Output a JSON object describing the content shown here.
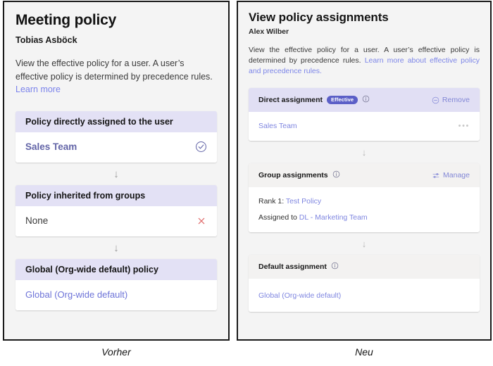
{
  "old_panel": {
    "title": "Meeting policy",
    "user": "Tobias Asböck",
    "description_before_link": "View the effective policy for a user. A user’s effective policy is determined by precedence rules. ",
    "link_label": "Learn more",
    "cards": [
      {
        "header": "Policy directly assigned to the user",
        "value": "Sales Team",
        "value_style": "strong-link",
        "status_icon": "check-circle-icon",
        "status_color": "#6264a7"
      },
      {
        "header": "Policy inherited from groups",
        "value": "None",
        "value_style": "plain",
        "status_icon": "close-x-icon",
        "status_color": "#e06c6c"
      },
      {
        "header": "Global (Org-wide default) policy",
        "value": "Global (Org-wide default)",
        "value_style": "link",
        "status_icon": "none",
        "status_color": ""
      }
    ],
    "arrow_glyph": "↓"
  },
  "new_panel": {
    "title": "View policy assignments",
    "user": "Alex Wilber",
    "description_before_link": "View the effective policy for a user. A user’s effective policy is determined by precedence rules. ",
    "link_label": "Learn more about effective policy and precedence rules.",
    "arrow_glyph": "↓",
    "cards": [
      {
        "header": "Direct assignment",
        "badge": "Effective",
        "info_icon": "info-circle-icon",
        "action_label": "Remove",
        "action_icon": "minus-circle-icon",
        "header_accent": true,
        "body_link": "Sales Team",
        "overflow_icon": "more-horizontal-icon",
        "overflow_glyph": "•••"
      },
      {
        "header": "Group assignments",
        "badge": "",
        "info_icon": "info-circle-icon",
        "action_label": "Manage",
        "action_icon": "settings-sliders-icon",
        "header_accent": false,
        "rank_prefix": "Rank 1: ",
        "rank_link": "Test Policy",
        "assigned_prefix": "Assigned to ",
        "assigned_link": "DL - Marketing Team"
      },
      {
        "header": "Default assignment",
        "badge": "",
        "info_icon": "info-circle-icon",
        "action_label": "",
        "header_accent": false,
        "body_link": "Global (Org-wide default)"
      }
    ]
  },
  "captions": {
    "old": "Vorher",
    "new": "Neu"
  },
  "colors": {
    "accent_purple": "#6264a7",
    "badge_bg": "#5b5fc7",
    "header_lavender": "#e3e1f5",
    "header_gray": "#f3f2f1",
    "link_purple": "#7f86e0",
    "danger_red": "#e06c6c"
  }
}
